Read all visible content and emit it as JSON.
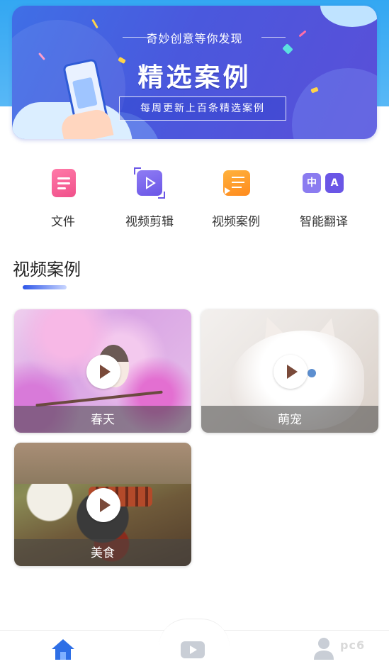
{
  "banner": {
    "slogan": "奇妙创意等你发现",
    "title": "精选案例",
    "subtitle": "每周更新上百条精选案例"
  },
  "categories": [
    {
      "label": "文件",
      "icon": "file-icon",
      "color": "#f0508a"
    },
    {
      "label": "视频剪辑",
      "icon": "video-edit-icon",
      "color": "#6a56e6"
    },
    {
      "label": "视频案例",
      "icon": "video-case-icon",
      "color": "#ff8a1d"
    },
    {
      "label": "智能翻译",
      "icon": "translate-icon",
      "color": "#6a56e6",
      "glyph_left": "中",
      "glyph_right": "A"
    }
  ],
  "section": {
    "title": "视频案例"
  },
  "videos": [
    {
      "caption": "春天",
      "icon": "play-icon"
    },
    {
      "caption": "萌宠",
      "icon": "play-icon"
    },
    {
      "caption": "美食",
      "icon": "play-icon"
    }
  ],
  "tabbar": {
    "items": [
      {
        "icon": "home-icon",
        "active": true
      },
      {
        "icon": "video-icon",
        "active": false
      },
      {
        "icon": "user-icon",
        "active": false
      }
    ],
    "accent": "#2e6fe6"
  },
  "watermark": "pc6"
}
